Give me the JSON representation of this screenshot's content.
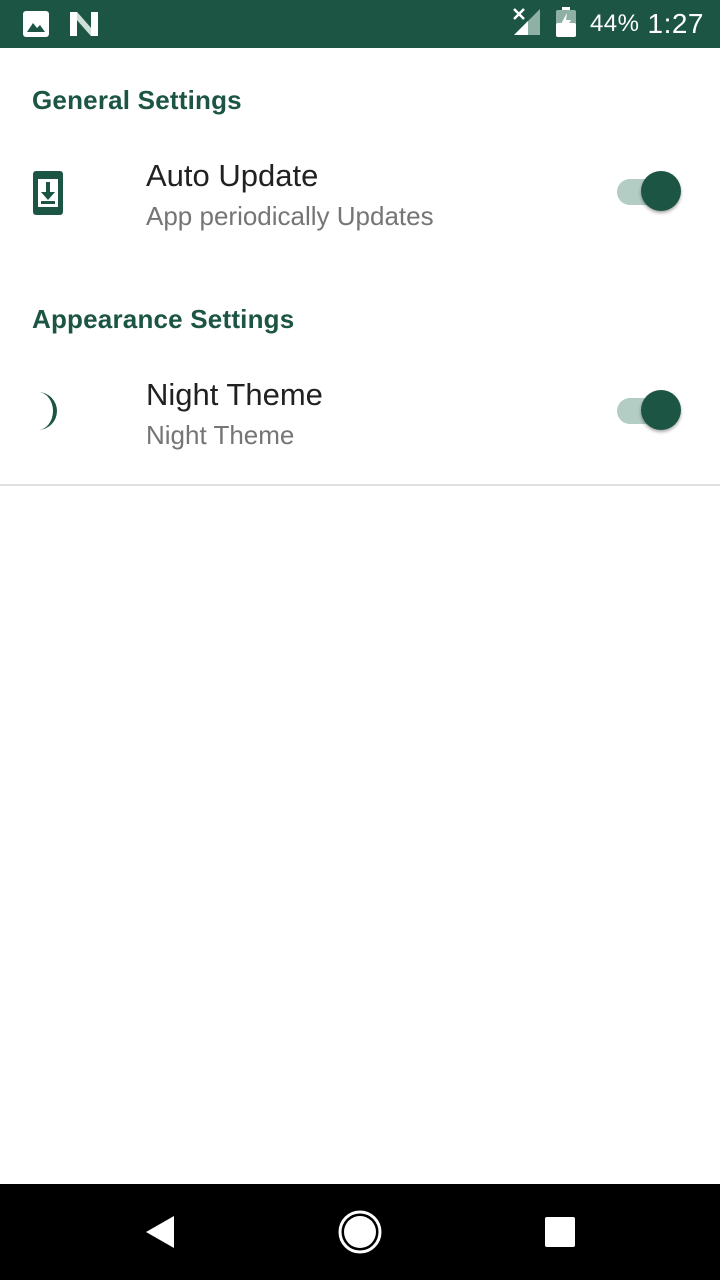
{
  "status_bar": {
    "background_color": "#1c5544",
    "left_icons": [
      "image-icon",
      "n-notification-icon"
    ],
    "right_icons": [
      "signal-no-service-icon",
      "battery-charging-icon"
    ],
    "battery_percent": "44%",
    "time": "1:27"
  },
  "sections": {
    "general": {
      "header": "General Settings",
      "item": {
        "icon": "system-update-icon",
        "title": "Auto Update",
        "summary": "App periodically Updates",
        "switch_on": true
      }
    },
    "appearance": {
      "header": "Appearance Settings",
      "item": {
        "icon": "moon-icon",
        "title": "Night Theme",
        "summary": "Night Theme",
        "switch_on": true
      }
    }
  },
  "colors": {
    "accent": "#1c5544",
    "switch_track": "#b3ccc4",
    "title_text": "#212121",
    "summary_text": "#757575"
  },
  "nav_bar": {
    "buttons": [
      "back-icon",
      "home-icon",
      "recents-icon"
    ]
  }
}
